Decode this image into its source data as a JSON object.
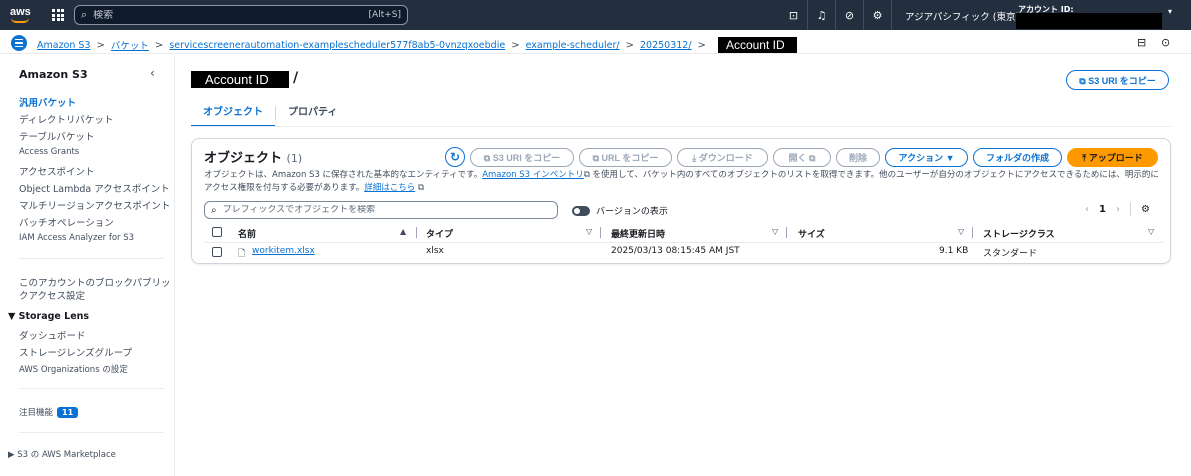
{
  "topnav": {
    "logo": "aws",
    "search_placeholder": "検索",
    "search_shortcut": "[Alt+S]",
    "icons": [
      "cloudshell-icon",
      "bell-icon",
      "help-icon",
      "settings-icon"
    ],
    "icon_glyphs": [
      "⊡",
      "♫",
      "⊘",
      "⚙"
    ],
    "region": "アジアパシフィック (東京) ▾",
    "account_label": "アカウント ID:",
    "account_caret": "▾"
  },
  "breadcrumb": {
    "items": [
      "Amazon S3",
      "バケット",
      "servicescreenerautomation-examplescheduler577f8ab5-0vnzqxoebdie",
      "example-scheduler/",
      "20250312/"
    ],
    "redacted_label": "Account ID",
    "separator": ">"
  },
  "sidebar": {
    "title": "Amazon S3",
    "close_glyph": "‹",
    "items": [
      "汎用バケット",
      "ディレクトリバケット",
      "テーブルバケット",
      "Access Grants",
      "アクセスポイント",
      "Object Lambda アクセスポイント",
      "マルチリージョンアクセスポイント",
      "バッチオペレーション",
      "IAM Access Analyzer for S3"
    ],
    "block_public_access_line1": "このアカウントのブロックパブリッ",
    "block_public_access_line2": "クアクセス設定",
    "storage_lens": {
      "title": "▼ Storage Lens",
      "items": [
        "ダッシュボード",
        "ストレージレンズグループ",
        "AWS Organizations の設定"
      ]
    },
    "featured": {
      "label": "注目機能",
      "count": "11"
    },
    "marketplace": "▶  S3 の AWS Marketplace"
  },
  "main": {
    "title_redacted": "Account ID",
    "title_slash": "/",
    "copy_s3_uri_top": "⧉  S3 URI をコピー",
    "tabs": [
      "オブジェクト",
      "プロパティ"
    ],
    "objects": {
      "title": "オブジェクト",
      "count": "(1)",
      "refresh_glyph": "↻",
      "buttons": {
        "copy_s3_uri": "⧉  S3 URI をコピー",
        "copy_url": "⧉  URL をコピー",
        "download": "⤓  ダウンロード",
        "open": "開く ⧉",
        "delete": "削除",
        "actions": "アクション ▼",
        "create_folder": "フォルダの作成",
        "upload": "⤒  アップロード"
      },
      "desc_part1": "オブジェクトは、Amazon S3 に保存された基本的なエンティティです。",
      "desc_link": "Amazon S3 インベントリ",
      "desc_part2": " を使用して、バケット内のすべてのオブジェクトのリストを取得できます。他のユーザーが自分のオブジェクトにアクセスできるためには、明示的にアクセス権限を付与する必要があります。",
      "desc_link2": "詳細はこちら",
      "filter_placeholder": "プレフィックスでオブジェクトを検索",
      "version_toggle": "バージョンの表示",
      "pager": {
        "prev": "‹",
        "page": "1",
        "next": "›",
        "settings": "⚙"
      },
      "columns": [
        "名前",
        "タイプ",
        "最終更新日時",
        "サイズ",
        "ストレージクラス"
      ],
      "rows": [
        {
          "name": "workitem.xlsx",
          "type": "xlsx",
          "modified": "2025/03/13 08:15:45 AM JST",
          "size": "9.1 KB",
          "storage_class": "スタンダード"
        }
      ]
    }
  },
  "colors": {
    "nav": "#232f3e",
    "accent": "#0972d3",
    "upload": "#ff9900"
  }
}
